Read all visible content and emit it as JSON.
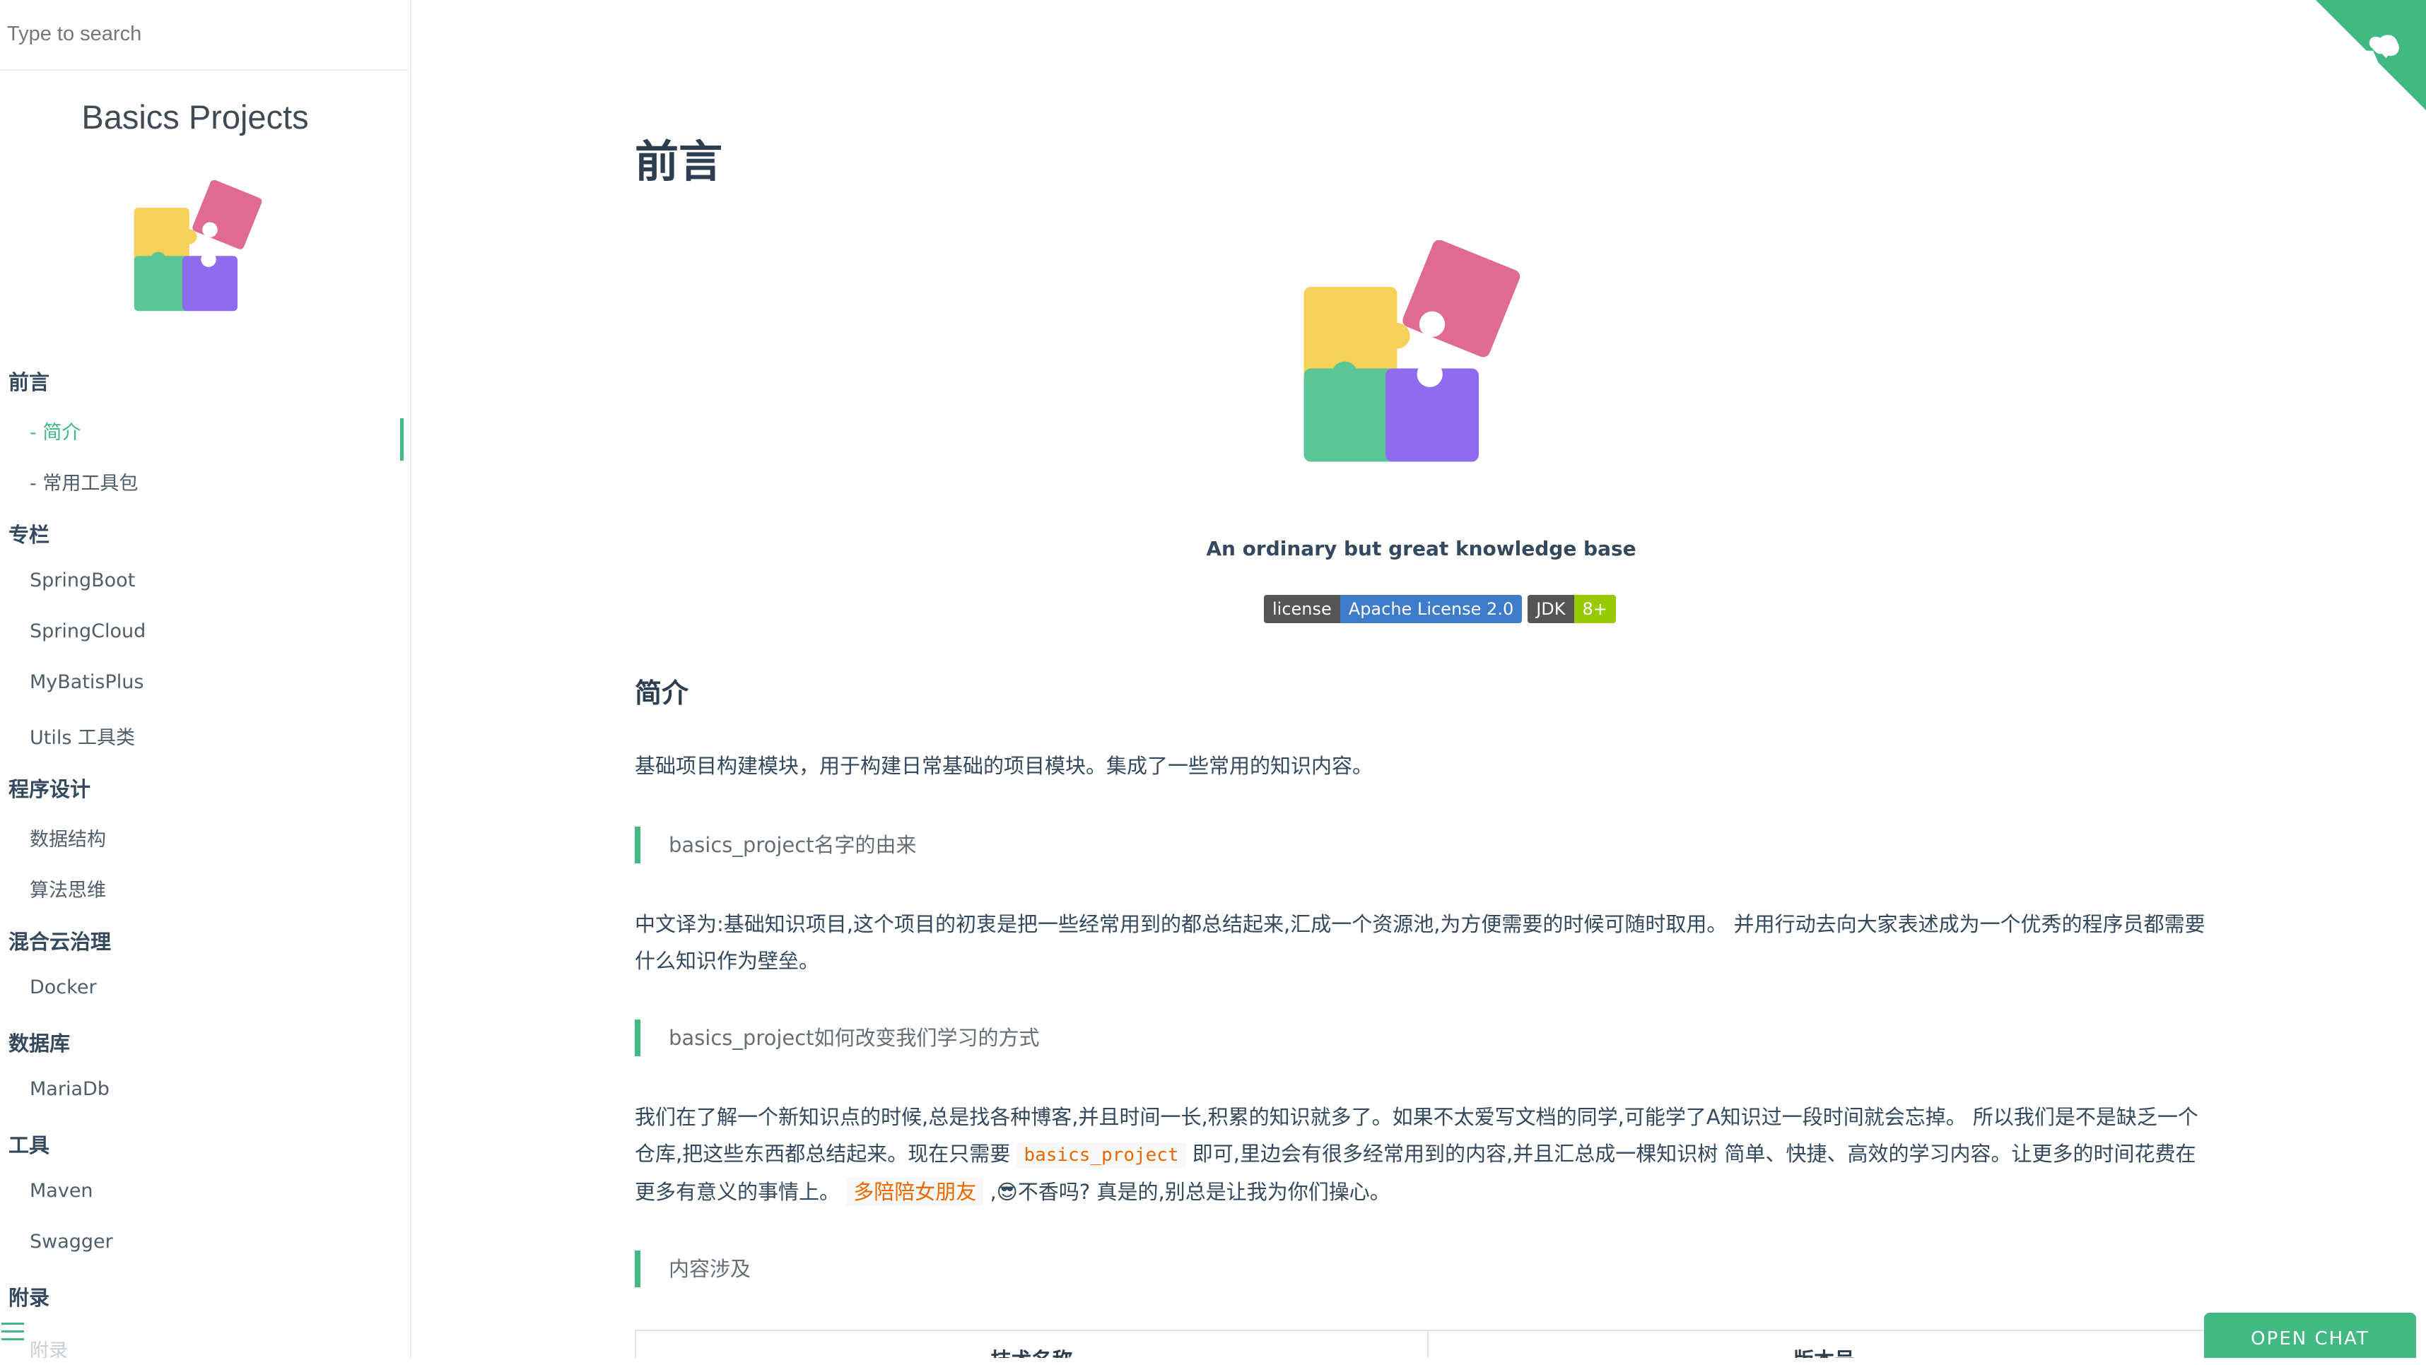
{
  "search": {
    "placeholder": "Type to search"
  },
  "sidebar": {
    "site_name": "Basics Projects",
    "sections": [
      {
        "label": "前言",
        "items": [
          {
            "label": "- 简介",
            "active": true
          },
          {
            "label": "- 常用工具包"
          }
        ]
      },
      {
        "label": "专栏",
        "items": [
          {
            "label": "SpringBoot"
          },
          {
            "label": "SpringCloud"
          },
          {
            "label": "MyBatisPlus"
          },
          {
            "label": "Utils 工具类"
          }
        ]
      },
      {
        "label": "程序设计",
        "items": [
          {
            "label": "数据结构"
          },
          {
            "label": "算法思维"
          }
        ]
      },
      {
        "label": "混合云治理",
        "items": [
          {
            "label": "Docker"
          }
        ]
      },
      {
        "label": "数据库",
        "items": [
          {
            "label": "MariaDb"
          }
        ]
      },
      {
        "label": "工具",
        "items": [
          {
            "label": "Maven"
          },
          {
            "label": "Swagger"
          }
        ]
      },
      {
        "label": "附录",
        "items": [
          {
            "label": "附录"
          }
        ]
      }
    ]
  },
  "main": {
    "title": "前言",
    "tagline": "An ordinary but great knowledge base",
    "badges": {
      "license_key": "license",
      "license_value": "Apache License 2.0",
      "jdk_key": "JDK",
      "jdk_value": "8+"
    },
    "section_title": "简介",
    "intro": "基础项目构建模块，用于构建日常基础的项目模块。集成了一些常用的知识内容。",
    "quote1": "basics_project名字的由来",
    "para1": "中文译为:基础知识项目,这个项目的初衷是把一些经常用到的都总结起来,汇成一个资源池,为方便需要的时候可随时取用。 并用行动去向大家表述成为一个优秀的程序员都需要什么知识作为壁垒。",
    "quote2": "basics_project如何改变我们学习的方式",
    "para2_part1": "我们在了解一个新知识点的时候,总是找各种博客,并且时间一长,积累的知识就多了。如果不太爱写文档的同学,可能学了A知识过一段时间就会忘掉。 所以我们是不是缺乏一个仓库,把这些东西都总结起来。现在只需要 ",
    "para2_code": "basics_project",
    "para2_part2": " 即可,里边会有很多经常用到的内容,并且汇总成一棵知识树 简单、快捷、高效的学习内容。让更多的时间花费在更多有意义的事情上。 ",
    "para2_tag": "多陪陪女朋友",
    "para2_emoji": " ,😎",
    "para2_part3": "不香吗? 真是的,别总是让我为你们操心。",
    "quote3": "内容涉及",
    "table_headers": [
      "技术名称",
      "版本号"
    ]
  },
  "chat": {
    "label": "OPEN CHAT"
  },
  "colors": {
    "accent": "#42b983",
    "text": "#34495e",
    "code": "#e96900"
  }
}
